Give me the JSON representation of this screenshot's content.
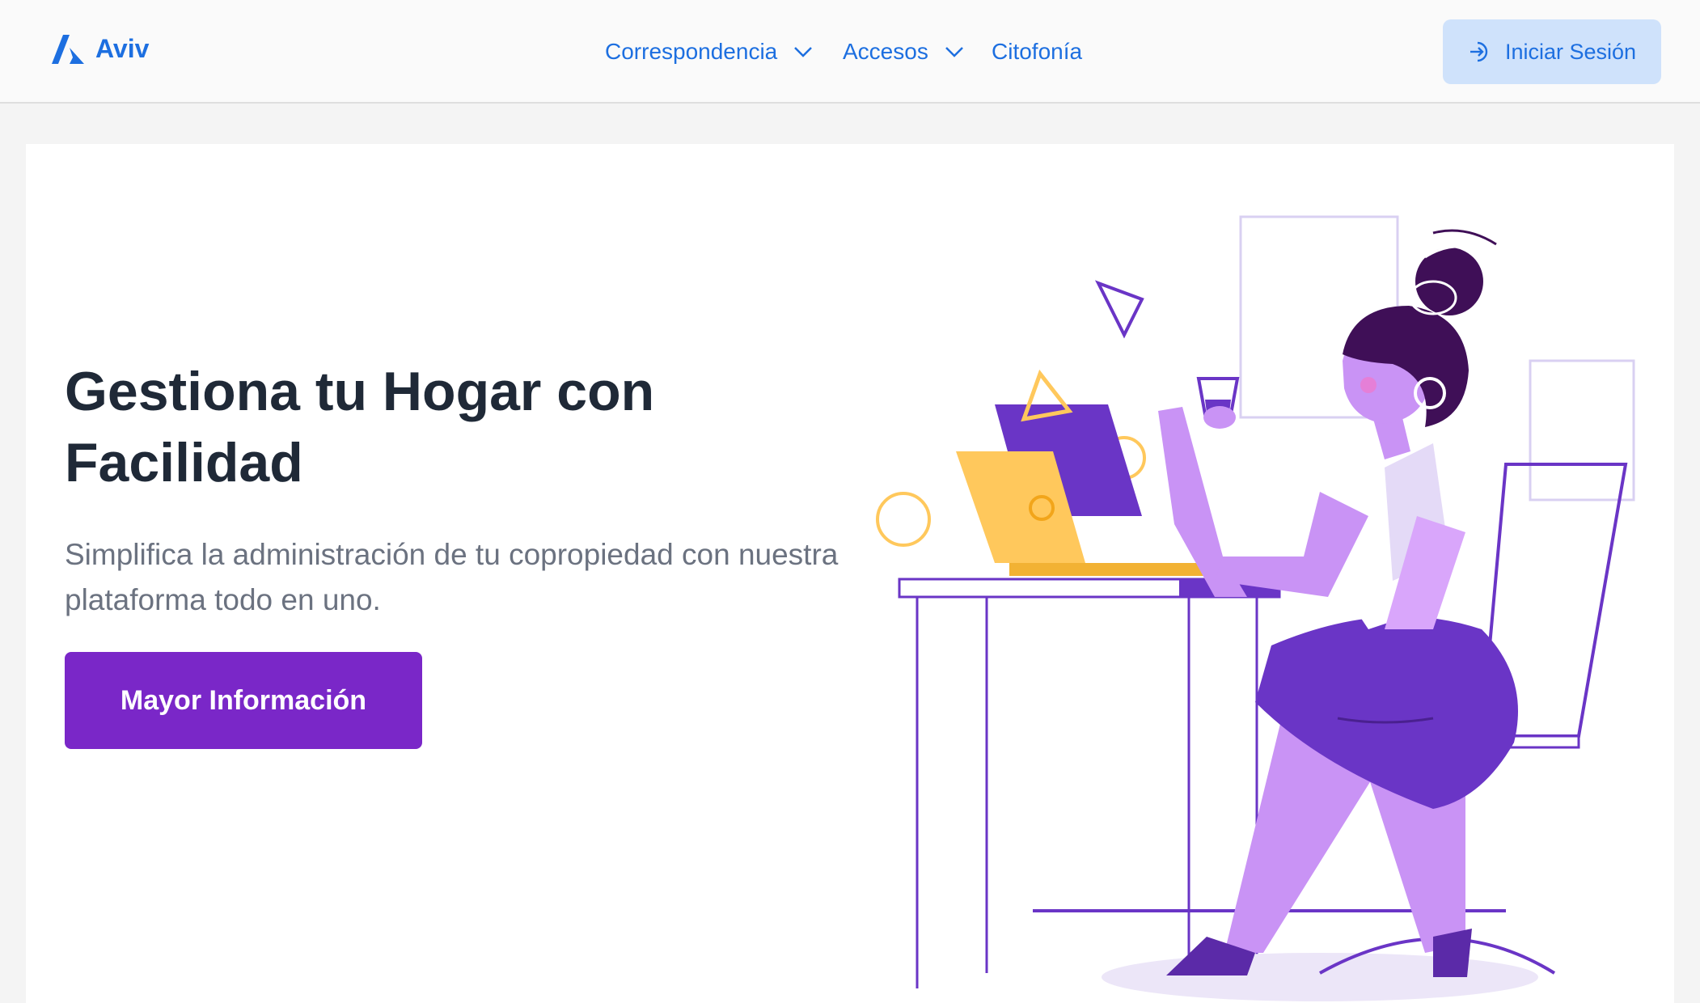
{
  "header": {
    "brand": "Aviv",
    "nav": [
      {
        "label": "Correspondencia",
        "has_dropdown": true
      },
      {
        "label": "Accesos",
        "has_dropdown": true
      },
      {
        "label": "Citofonía",
        "has_dropdown": false
      }
    ],
    "login_label": "Iniciar Sesión",
    "login_icon": "login-icon"
  },
  "hero": {
    "title": "Gestiona tu Hogar con Facilidad",
    "subtitle": "Simplifica la administración de tu copropiedad con nuestra plataforma todo en uno.",
    "cta_label": "Mayor Información"
  },
  "colors": {
    "brand": "#1d6fe0",
    "cta": "#7a27c8",
    "login_bg": "#cfe2fb",
    "illustration_purple": "#6a35c6",
    "illustration_yellow": "#ffc85c"
  }
}
